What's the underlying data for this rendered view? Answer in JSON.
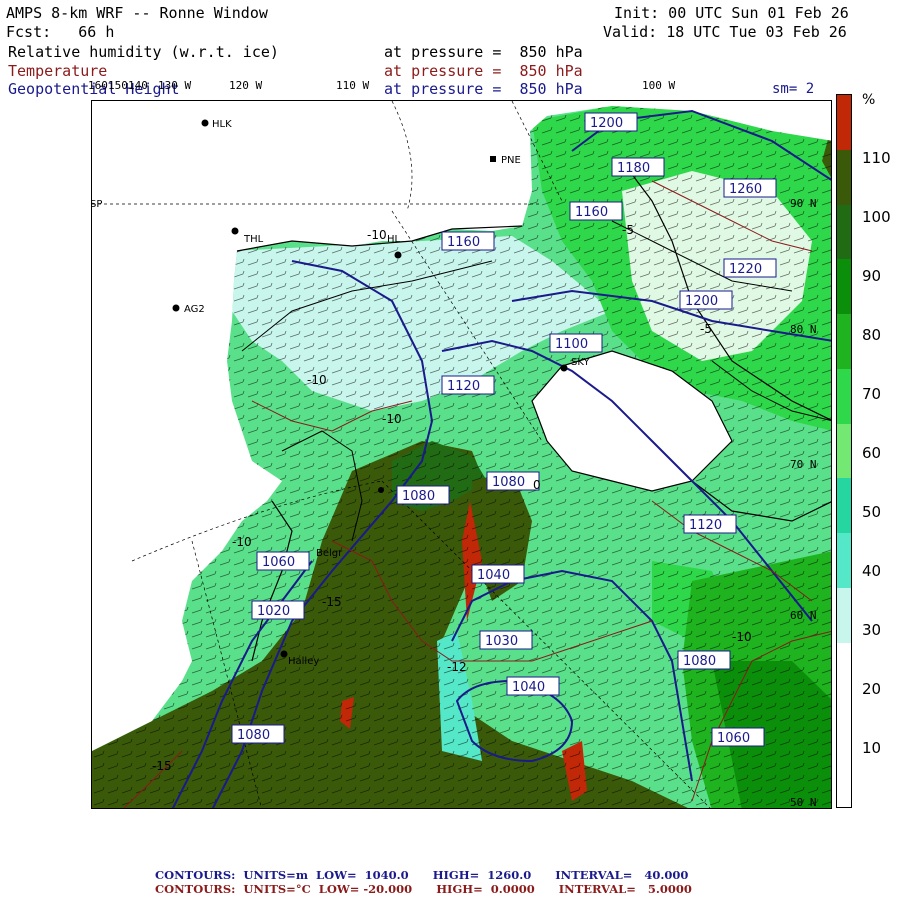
{
  "header": {
    "model": "AMPS 8-km WRF -- Ronne Window",
    "fcst": "Fcst:   66 h",
    "init": "Init: 00 UTC Sun 01 Feb 26",
    "valid": "Valid: 18 UTC Tue 03 Feb 26",
    "field1": "Relative humidity (w.r.t. ice)",
    "field2": "Temperature",
    "field3": "Geopotential Height",
    "level1": "at pressure =  850 hPa",
    "level2": "at pressure =  850 hPa",
    "level3": "at pressure =  850 hPa",
    "sm": "sm= 2"
  },
  "lon_labels": [
    "160",
    "150",
    "140",
    "130 W",
    "120 W",
    "110 W",
    "100 W"
  ],
  "lat_labels": [
    "90 N",
    "80 N",
    "70 N",
    "60 N",
    "50 N"
  ],
  "colorbar": {
    "unit": "%",
    "ticks": [
      "110",
      "100",
      "90",
      "80",
      "70",
      "60",
      "50",
      "40",
      "30",
      "20",
      "10"
    ],
    "colors": [
      "#c02808",
      "#3a5a0a",
      "#226b15",
      "#0b8f0b",
      "#1fb31f",
      "#2fd84a",
      "#73e873",
      "#26d6a0",
      "#55e8c8",
      "#c8f5ec",
      "#ffffff",
      "#ffffff",
      "#ffffff"
    ]
  },
  "stations": [
    {
      "name": "HLK"
    },
    {
      "name": "PNE"
    },
    {
      "name": "THL"
    },
    {
      "name": "HL"
    },
    {
      "name": "AG2"
    },
    {
      "name": "SKY"
    },
    {
      "name": "Halley"
    },
    {
      "name": "Belgr"
    },
    {
      "name": "SP"
    }
  ],
  "height_labels": [
    "1200",
    "1220",
    "1260",
    "1200",
    "1180",
    "1160",
    "1100",
    "1160",
    "1120",
    "1080",
    "1080",
    "1120",
    "1060",
    "1040",
    "1030",
    "1040",
    "1080",
    "1060",
    "1020",
    "1080"
  ],
  "temp_labels": [
    "-10",
    "-10",
    "-10",
    "-15",
    "-12",
    "-10",
    "-5",
    "-15",
    "-5",
    "0",
    "-10"
  ],
  "colors": {
    "height_contour": "#1a1a8c",
    "temp_contour": "#8b1a1a",
    "coast": "#000000"
  },
  "legend": {
    "line1": "CONTOURS:  UNITS=m  LOW=  1040.0      HIGH=  1260.0      INTERVAL=   40.000",
    "line2": "CONTOURS:  UNITS=°C  LOW= -20.000      HIGH=  0.0000      INTERVAL=   5.0000"
  }
}
